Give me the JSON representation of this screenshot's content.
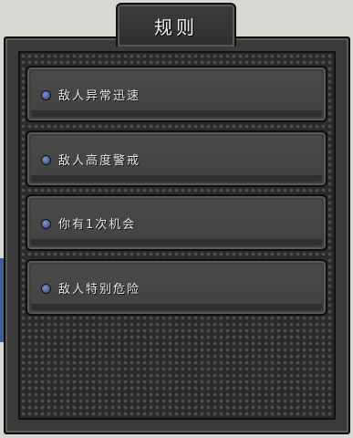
{
  "title": "规则",
  "rules": [
    {
      "label": "敌人异常迅速"
    },
    {
      "label": "敌人高度警戒"
    },
    {
      "label": "你有1次机会"
    },
    {
      "label": "敌人特别危险"
    }
  ],
  "colors": {
    "panel": "#3a3a3a",
    "mesh": "#2a2a2a",
    "bullet": "#3f5f9a",
    "text": "#e6e6e6"
  }
}
